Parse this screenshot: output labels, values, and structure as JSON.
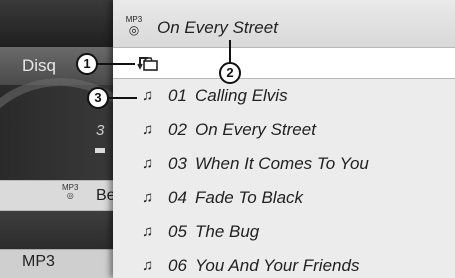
{
  "background": {
    "source_label": "Disq",
    "track_digit": "3",
    "light_row_icon_top": "MP3",
    "light_row_text": "Be",
    "bottom_label": "MP3"
  },
  "header": {
    "icon_text": "MP3",
    "title": "On Every Street"
  },
  "tracks": [
    {
      "number": "01",
      "title": "Calling Elvis"
    },
    {
      "number": "02",
      "title": "On Every Street"
    },
    {
      "number": "03",
      "title": "When It Comes To You"
    },
    {
      "number": "04",
      "title": "Fade To Black"
    },
    {
      "number": "05",
      "title": "The Bug"
    },
    {
      "number": "06",
      "title": "You And Your Friends"
    }
  ],
  "callouts": [
    "1",
    "2",
    "3"
  ],
  "icons": {
    "back": "folder-up-icon",
    "track": "music-note-icon",
    "disc": "disc-icon"
  }
}
